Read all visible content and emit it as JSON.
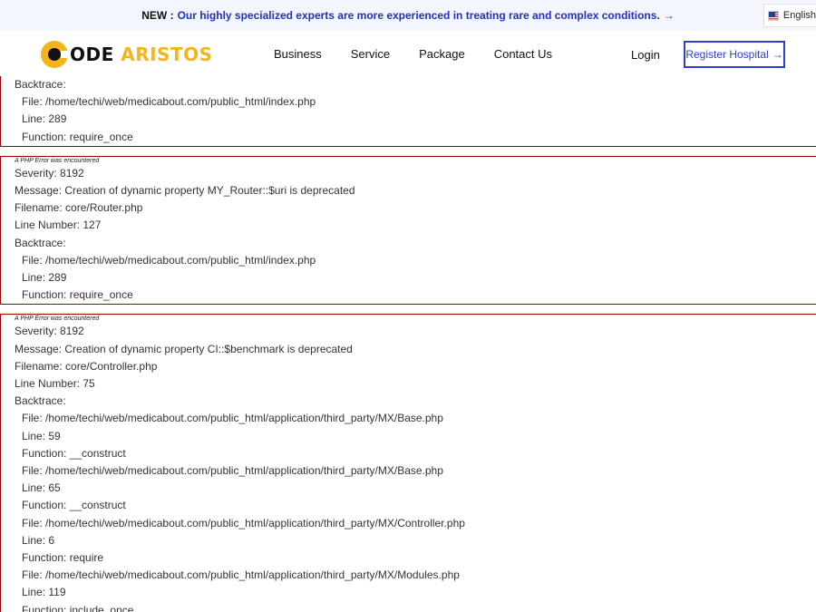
{
  "announcement": {
    "badge": "NEW :",
    "message": "Our highly specialized experts are more experienced in treating rare and complex conditions.",
    "arrow": "→",
    "language": "English"
  },
  "nav": {
    "logo_part1": "ODE",
    "logo_part2": "ARISTOS",
    "items": [
      "Business",
      "Service",
      "Package",
      "Contact Us"
    ],
    "login": "Login",
    "register": "Register Hospital",
    "register_arrow": "→"
  },
  "errors": {
    "block1": {
      "backtrace_label": "Backtrace:",
      "trace": [
        {
          "file": "File: /home/techi/web/medicabout.com/public_html/index.php",
          "line": "Line: 289",
          "function": "Function: require_once"
        }
      ]
    },
    "block2": {
      "heading": "A PHP Error was encountered",
      "severity": "Severity: 8192",
      "message": "Message: Creation of dynamic property MY_Router::$uri is deprecated",
      "filename": "Filename: core/Router.php",
      "line_number": "Line Number: 127",
      "backtrace_label": "Backtrace:",
      "trace": [
        {
          "file": "File: /home/techi/web/medicabout.com/public_html/index.php",
          "line": "Line: 289",
          "function": "Function: require_once"
        }
      ]
    },
    "block3": {
      "heading": "A PHP Error was encountered",
      "severity": "Severity: 8192",
      "message": "Message: Creation of dynamic property CI::$benchmark is deprecated",
      "filename": "Filename: core/Controller.php",
      "line_number": "Line Number: 75",
      "backtrace_label": "Backtrace:",
      "trace": [
        {
          "file": "File: /home/techi/web/medicabout.com/public_html/application/third_party/MX/Base.php",
          "line": "Line: 59",
          "function": "Function: __construct"
        },
        {
          "file": "File: /home/techi/web/medicabout.com/public_html/application/third_party/MX/Base.php",
          "line": "Line: 65",
          "function": "Function: __construct"
        },
        {
          "file": "File: /home/techi/web/medicabout.com/public_html/application/third_party/MX/Controller.php",
          "line": "Line: 6",
          "function": "Function: require"
        },
        {
          "file": "File: /home/techi/web/medicabout.com/public_html/application/third_party/MX/Modules.php",
          "line": "Line: 119",
          "function": "Function: include_once"
        }
      ]
    }
  },
  "colors": {
    "accent_blue": "#2b3fd1",
    "logo_gold": "#f5b41c",
    "error_border": "#990000"
  }
}
